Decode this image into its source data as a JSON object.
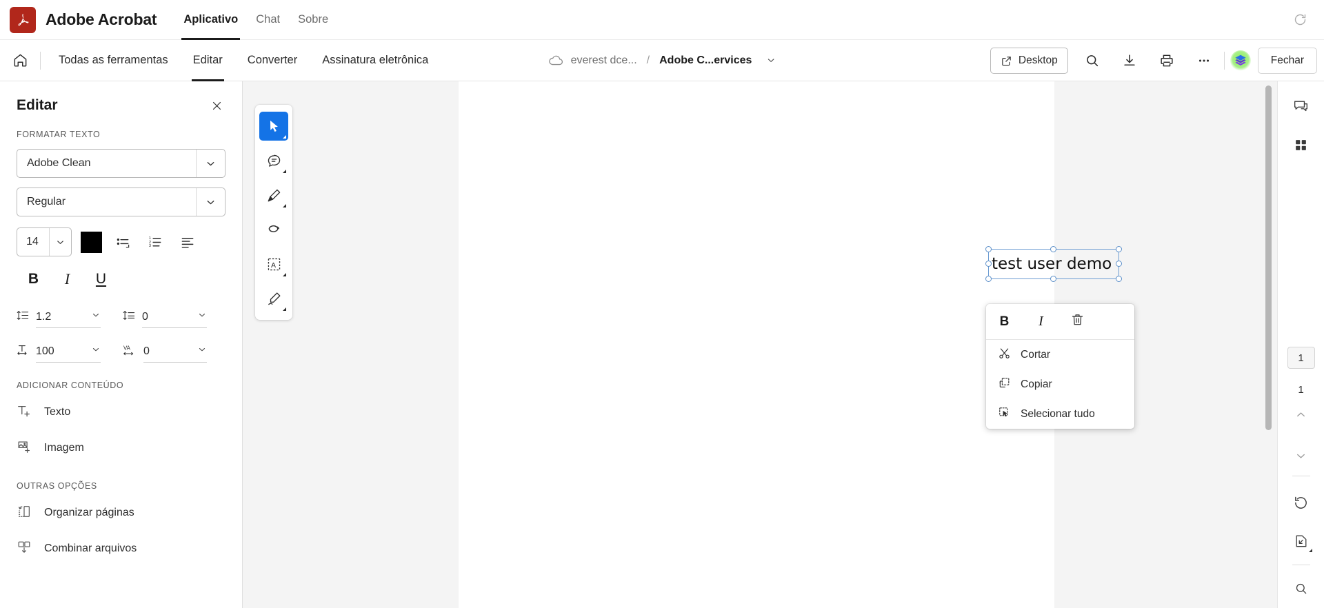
{
  "topbar": {
    "logo_icon": "acrobat-logo-icon",
    "brand_title": "Adobe Acrobat",
    "nav": [
      {
        "label": "Aplicativo",
        "active": true
      },
      {
        "label": "Chat",
        "active": false
      },
      {
        "label": "Sobre",
        "active": false
      }
    ],
    "refresh_icon": "refresh-icon",
    "brand_color": "#b1271b"
  },
  "toolbar": {
    "home_icon": "home-icon",
    "tabs": [
      {
        "label": "Todas as ferramentas",
        "active": false
      },
      {
        "label": "Editar",
        "active": true
      },
      {
        "label": "Converter",
        "active": false
      },
      {
        "label": "Assinatura eletrônica",
        "active": false
      }
    ],
    "breadcrumb": {
      "cloud_icon": "cloud-icon",
      "path": "everest dce...",
      "separator": "/",
      "file": "Adobe C...ervices",
      "chevron_icon": "chevron-down-icon"
    },
    "desktop_label": "Desktop",
    "desktop_icon": "external-link-icon",
    "search_icon": "search-icon",
    "download_icon": "download-icon",
    "print_icon": "print-icon",
    "more_icon": "more-options-icon",
    "avatar_icon": "user-avatar-icon",
    "close_label": "Fechar"
  },
  "leftpanel": {
    "title": "Editar",
    "close_icon": "close-icon",
    "format_label": "FORMATAR TEXTO",
    "font_family": "Adobe Clean",
    "font_style": "Regular",
    "font_size": "14",
    "color_value": "#000000",
    "list_icons": [
      "bulleted-list-icon",
      "numbered-list-icon",
      "text-align-icon"
    ],
    "style_buttons": [
      {
        "label": "B",
        "name": "bold-button"
      },
      {
        "label": "I",
        "name": "italic-button"
      },
      {
        "label": "U",
        "name": "underline-button"
      }
    ],
    "spacing": [
      {
        "icon": "line-spacing-icon",
        "value": "1.2",
        "name": "line-spacing-field"
      },
      {
        "icon": "paragraph-spacing-icon",
        "value": "0",
        "name": "paragraph-spacing-field"
      },
      {
        "icon": "horizontal-scale-icon",
        "value": "100",
        "name": "horizontal-scale-field"
      },
      {
        "icon": "letter-spacing-icon",
        "value": "0",
        "name": "letter-spacing-field"
      }
    ],
    "add_content_label": "ADICIONAR CONTEÚDO",
    "add_items": [
      {
        "icon": "add-text-icon",
        "label": "Texto"
      },
      {
        "icon": "add-image-icon",
        "label": "Imagem"
      }
    ],
    "other_options_label": "OUTRAS OPÇÕES",
    "other_items": [
      {
        "icon": "organize-pages-icon",
        "label": "Organizar páginas"
      },
      {
        "icon": "combine-files-icon",
        "label": "Combinar arquivos"
      }
    ]
  },
  "toolstrip": {
    "tools": [
      {
        "icon": "select-cursor-icon",
        "active": true,
        "caret": true
      },
      {
        "icon": "comment-icon",
        "active": false,
        "caret": true
      },
      {
        "icon": "highlighter-icon",
        "active": false,
        "caret": true
      },
      {
        "icon": "lasso-draw-icon",
        "active": false,
        "caret": false
      },
      {
        "icon": "text-select-icon",
        "active": false,
        "caret": true
      },
      {
        "icon": "sign-pen-icon",
        "active": false,
        "caret": true
      }
    ],
    "active_color": "#1473e6"
  },
  "document": {
    "selected_text": "test user demo",
    "selection_color": "#6b9bd2"
  },
  "contextmenu": {
    "tools": [
      {
        "label": "B",
        "name": "ctx-bold-button"
      },
      {
        "label": "I",
        "name": "ctx-italic-button"
      },
      {
        "label": "",
        "name": "ctx-delete-button",
        "icon": "trash-icon"
      }
    ],
    "items": [
      {
        "icon": "cut-icon",
        "label": "Cortar"
      },
      {
        "icon": "copy-icon",
        "label": "Copiar"
      },
      {
        "icon": "select-all-icon",
        "label": "Selecionar tudo"
      }
    ]
  },
  "rightrail": {
    "comment_icon": "comment-panel-icon",
    "thumbnails_icon": "page-thumbnails-icon",
    "current_page": "1",
    "total_pages": "1",
    "prev_icon": "chevron-up-icon",
    "next_icon": "chevron-down-icon",
    "rotate_icon": "rotate-icon",
    "fitpage_icon": "fit-page-icon"
  }
}
